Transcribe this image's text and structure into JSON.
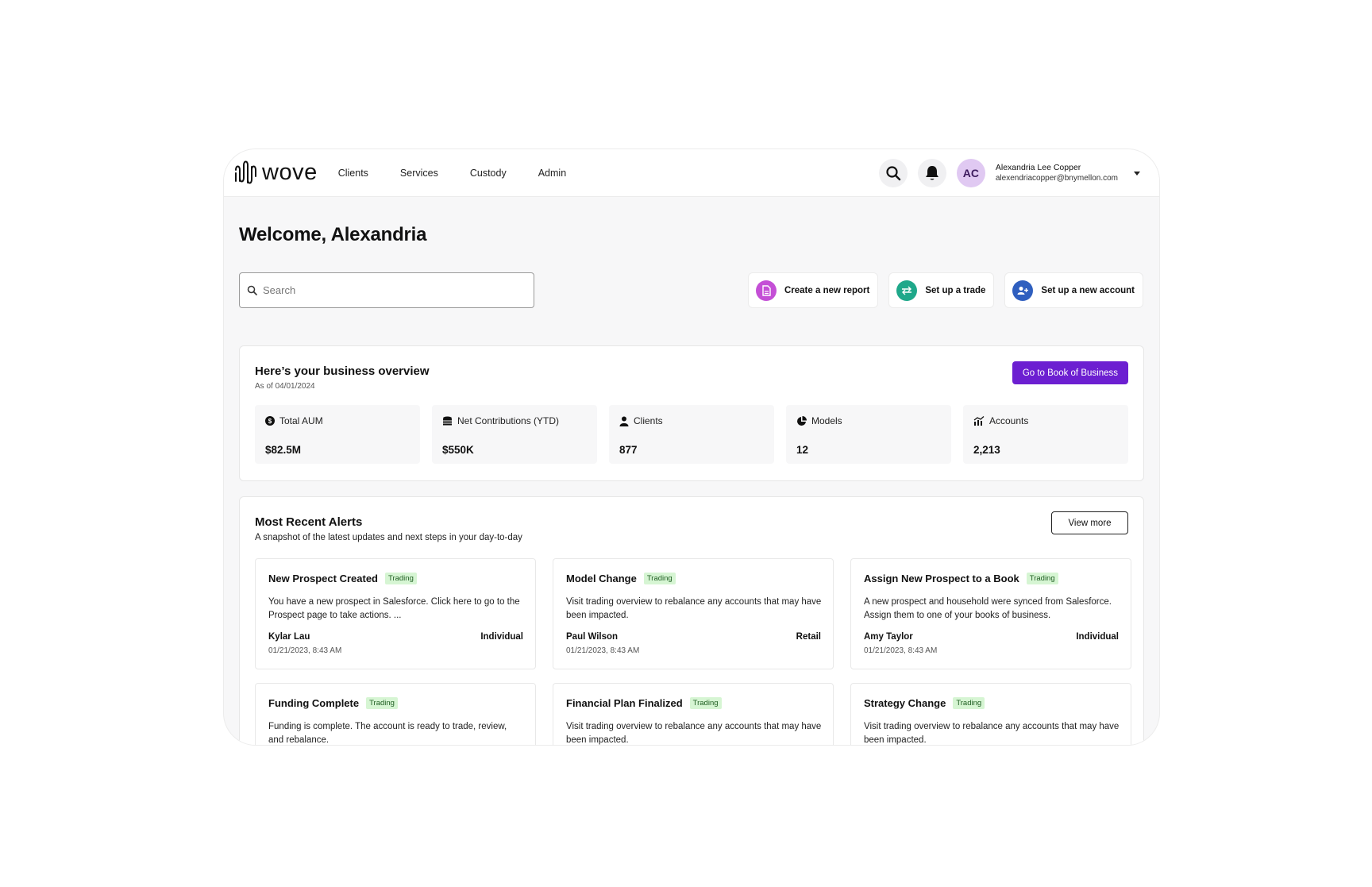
{
  "brand": {
    "name": "wove"
  },
  "nav": [
    "Clients",
    "Services",
    "Custody",
    "Admin"
  ],
  "user": {
    "initials": "AC",
    "name": "Alexandria Lee Copper",
    "email": "alexendriacopper@bnymellon.com"
  },
  "welcome": "Welcome, Alexandria",
  "search": {
    "placeholder": "Search",
    "value": ""
  },
  "quick_actions": [
    {
      "label": "Create a new report",
      "icon": "report-icon",
      "color": "#c44fd6"
    },
    {
      "label": "Set up a trade",
      "icon": "swap-arrows-icon",
      "color": "#1fa88a"
    },
    {
      "label": "Set up a new account",
      "icon": "add-user-icon",
      "color": "#2f5fbf"
    }
  ],
  "overview": {
    "title": "Here’s your business overview",
    "as_of": "As of 04/01/2024",
    "cta": "Go to Book of Business",
    "stats": [
      {
        "label": "Total AUM",
        "value": "$82.5M",
        "icon": "dollar-icon"
      },
      {
        "label": "Net Contributions (YTD)",
        "value": "$550K",
        "icon": "coins-icon"
      },
      {
        "label": "Clients",
        "value": "877",
        "icon": "person-icon"
      },
      {
        "label": "Models",
        "value": "12",
        "icon": "pie-icon"
      },
      {
        "label": "Accounts",
        "value": "2,213",
        "icon": "chart-up-icon"
      }
    ]
  },
  "alerts": {
    "title": "Most Recent Alerts",
    "subtitle": "A snapshot of the latest updates and next steps in your day-to-day",
    "view_more": "View more",
    "items": [
      {
        "title": "New Prospect Created",
        "tag": "Trading",
        "desc": "You have a new prospect in Salesforce. Click here to go to the Prospect page to take actions. ...",
        "person": "Kylar Lau",
        "type": "Individual",
        "time": "01/21/2023, 8:43 AM"
      },
      {
        "title": "Model Change",
        "tag": "Trading",
        "desc": "Visit trading overview to rebalance any accounts that may have been impacted.",
        "person": "Paul Wilson",
        "type": "Retail",
        "time": "01/21/2023, 8:43 AM"
      },
      {
        "title": "Assign New Prospect to a Book",
        "tag": "Trading",
        "desc": "A new prospect and household were synced from Salesforce. Assign them to one of your books of business.",
        "person": "Amy Taylor",
        "type": "Individual",
        "time": "01/21/2023, 8:43 AM"
      },
      {
        "title": "Funding Complete",
        "tag": "Trading",
        "desc": "Funding is complete. The account is ready to trade, review, and rebalance.",
        "person": "",
        "type": "",
        "time": ""
      },
      {
        "title": "Financial Plan Finalized",
        "tag": "Trading",
        "desc": "Visit trading overview to rebalance any accounts that may have been impacted.",
        "person": "",
        "type": "",
        "time": ""
      },
      {
        "title": "Strategy Change",
        "tag": "Trading",
        "desc": "Visit trading overview to rebalance any accounts that may have been impacted.",
        "person": "",
        "type": "",
        "time": ""
      }
    ]
  }
}
